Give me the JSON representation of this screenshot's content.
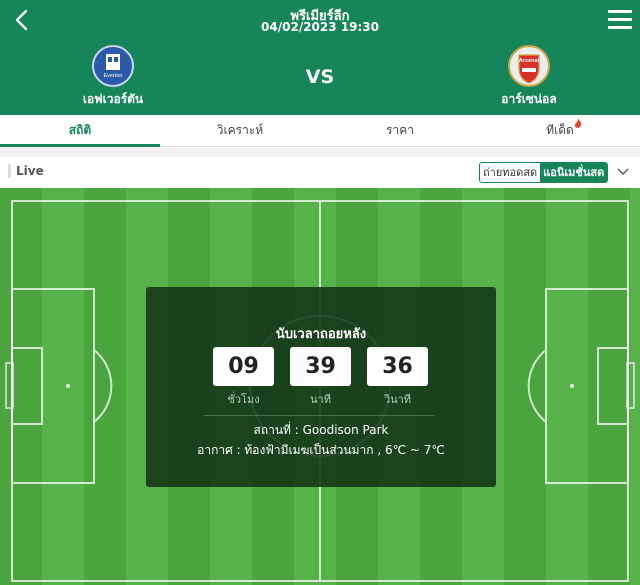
{
  "header": {
    "league": "พรีเมียร์ลีก",
    "datetime": "04/02/2023 19:30",
    "vs": "VS",
    "home_team": {
      "name": "เอฟเวอร์ตัน",
      "logo_icon": "everton-crest-icon",
      "logo_text": "Everton"
    },
    "away_team": {
      "name": "อาร์เซน่อล",
      "logo_icon": "arsenal-crest-icon",
      "logo_text": "Arsenal"
    }
  },
  "tabs": [
    {
      "label": "สถิติ",
      "active": true
    },
    {
      "label": "วิเคราะห์",
      "active": false
    },
    {
      "label": "ราคา",
      "active": false
    },
    {
      "label": "ทีเด็ด",
      "active": false,
      "badge_icon": "fire-icon"
    }
  ],
  "live": {
    "label": "Live",
    "toggle_options": [
      {
        "label": "ถ่ายทอดสด",
        "selected": false
      },
      {
        "label": "แอนิเมชั่นสด",
        "selected": true
      }
    ]
  },
  "countdown": {
    "title": "นับเวลาถอยหลัง",
    "hours": "09",
    "minutes": "39",
    "seconds": "36",
    "hours_label": "ชั่วโมง",
    "minutes_label": "นาที",
    "seconds_label": "วินาที",
    "venue": "สถานที่ : Goodison Park",
    "weather": "อากาศ : ท้องฟ้ามีเมฆเป็นส่วนมาก , 6℃ ~ 7℃"
  },
  "colors": {
    "brand_green": "#16855a",
    "pitch_light": "#56b249",
    "pitch_dark": "#4aa53f",
    "everton_blue": "#2a5aa8",
    "arsenal_red": "#d8302b"
  }
}
